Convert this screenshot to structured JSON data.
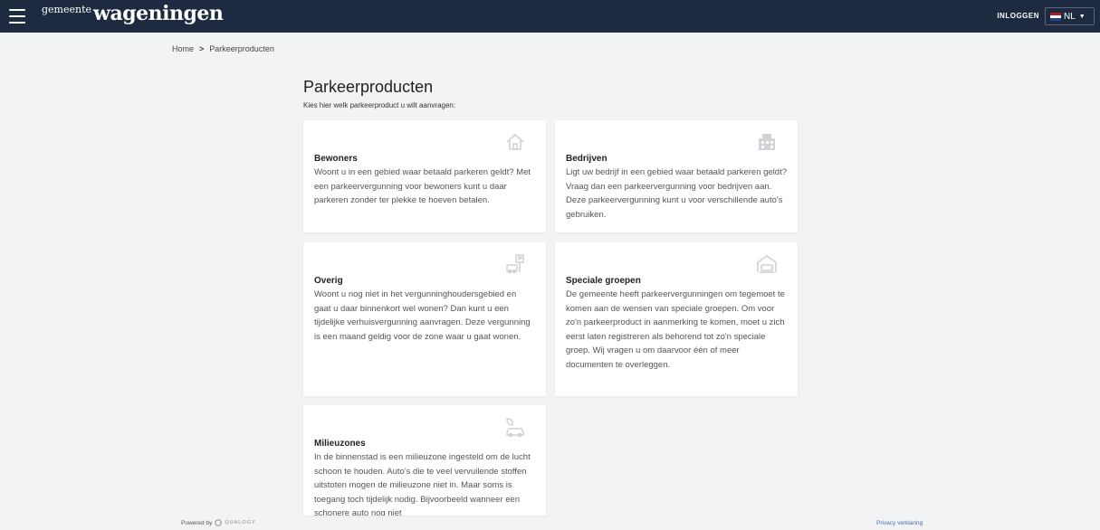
{
  "header": {
    "logo_small": "gemeente",
    "logo_big": "wageningen",
    "login_label": "INLOGGEN",
    "language": "NL",
    "colors": {
      "bar": "#1d2a3f"
    }
  },
  "breadcrumb": {
    "home": "Home",
    "separator": ">",
    "current": "Parkeerproducten"
  },
  "page": {
    "title": "Parkeerproducten",
    "subtitle": "Kies hier welk parkeerproduct u wilt aanvragen:"
  },
  "cards": [
    {
      "title": "Bewoners",
      "icon": "house-icon",
      "text": "Woont u in een gebied waar betaald parkeren geldt? Met een parkeervergunning voor bewoners kunt u daar parkeren zonder ter plekke te hoeven betalen."
    },
    {
      "title": "Bedrijven",
      "icon": "office-building-icon",
      "text": "Ligt uw bedrijf in een gebied waar betaald parkeren geldt? Vraag dan een parkeervergunning voor bedrijven aan. Deze parkeervergunning kunt u voor verschillende auto's gebruiken."
    },
    {
      "title": "Overig",
      "icon": "parking-sign-icon",
      "text": "Woont u nog niet in het vergunninghoudersgebied en gaat u daar binnenkort wel wonen? Dan kunt u een tijdelijke verhuisvergunning aanvragen. Deze vergunning is een maand geldig voor de zone waar u gaat wonen."
    },
    {
      "title": "Speciale groepen",
      "icon": "car-garage-icon",
      "text": "De gemeente heeft parkeervergunningen om tegemoet te komen aan de wensen van speciale groepen. Om voor zo'n parkeerproduct in aanmerking te komen, moet u zich eerst laten registreren als behorend tot zo'n speciale groep. Wij vragen u om daarvoor één of meer documenten te overleggen."
    },
    {
      "title": "Milieuzones",
      "icon": "eco-car-icon",
      "text": "In de binnenstad is een milieuzone ingesteld om de lucht schoon te houden. Auto's die te veel vervuilende stoffen uitstoten mogen de milieuzone niet in. Maar soms is toegang toch tijdelijk nodig. Bijvoorbeeld wanneer een schonere auto nog niet"
    }
  ],
  "footer": {
    "powered_by": "Powered by",
    "brand": "QUALOGY",
    "privacy": "Privacy verklaring"
  }
}
